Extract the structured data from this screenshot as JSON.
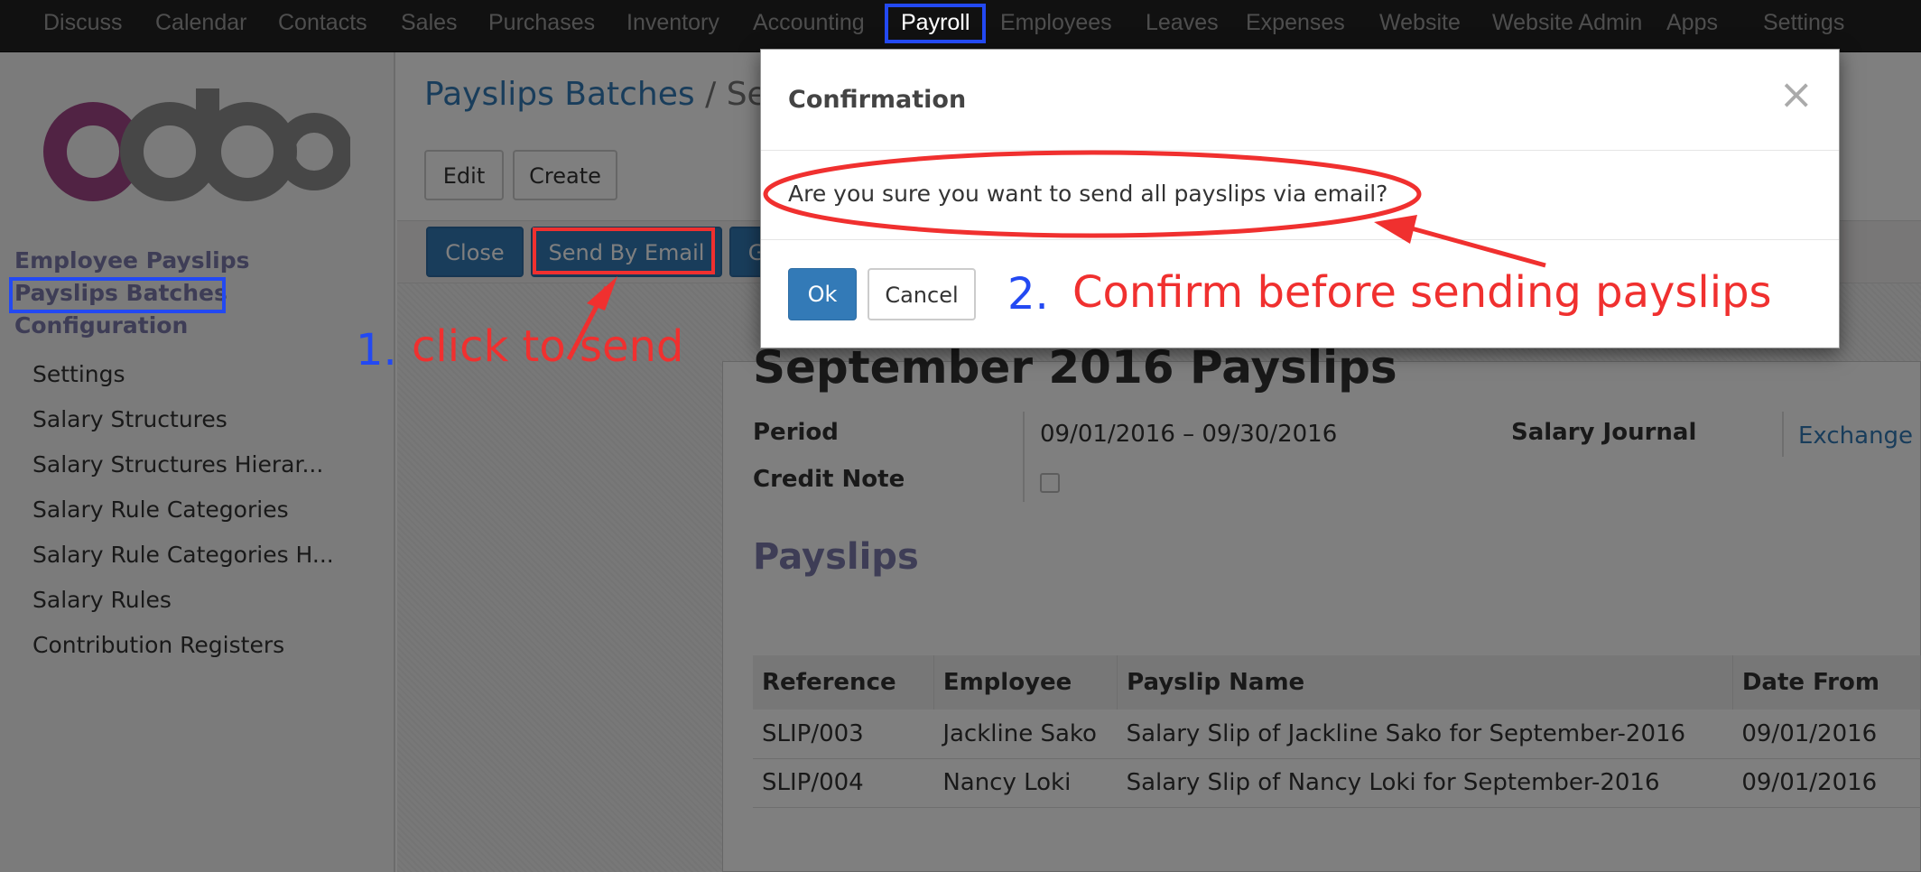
{
  "topbar": {
    "items": [
      "Discuss",
      "Calendar",
      "Contacts",
      "Sales",
      "Purchases",
      "Inventory",
      "Accounting",
      "Payroll",
      "Employees",
      "Leaves",
      "Expenses",
      "Website",
      "Website Admin",
      "Apps",
      "Settings"
    ],
    "active": "Payroll"
  },
  "sidebar": {
    "logo_text": "odoo",
    "employee_payslips": "Employee Payslips",
    "payslips_batches": "Payslips Batches",
    "configuration": "Configuration",
    "config_items": [
      "Settings",
      "Salary Structures",
      "Salary Structures Hierar...",
      "Salary Rule Categories",
      "Salary Rule Categories H...",
      "Salary Rules",
      "Contribution Registers"
    ]
  },
  "breadcrumb": {
    "parent": "Payslips Batches",
    "separator": "/",
    "current": "Se"
  },
  "toolbar": {
    "edit": "Edit",
    "create": "Create"
  },
  "statusbar": {
    "close": "Close",
    "send_by_email": "Send By Email",
    "generate_partial": "G"
  },
  "record": {
    "title": "September 2016 Payslips",
    "period_label": "Period",
    "period_from": "09/01/2016",
    "period_dash": "–",
    "period_to": "09/30/2016",
    "credit_note_label": "Credit Note",
    "salary_journal_label": "Salary Journal",
    "salary_journal_value": "Exchange D",
    "section_title": "Payslips"
  },
  "payslip_table": {
    "headers": [
      "Reference",
      "Employee",
      "Payslip Name",
      "Date From"
    ],
    "rows": [
      [
        "SLIP/003",
        "Jackline Sako",
        "Salary Slip of Jackline Sako for September-2016",
        "09/01/2016"
      ],
      [
        "SLIP/004",
        "Nancy Loki",
        "Salary Slip of Nancy Loki for September-2016",
        "09/01/2016"
      ]
    ]
  },
  "modal": {
    "title": "Confirmation",
    "close_glyph": "×",
    "message": "Are you sure you want to send all payslips via email?",
    "ok": "Ok",
    "cancel": "Cancel"
  },
  "annotations": {
    "step1_num": "1.",
    "step1_text": "click to send",
    "step2_num": "2.",
    "step2_text": "Confirm before sending payslips"
  },
  "colors": {
    "annotation_red": "#f0302f",
    "annotation_blue": "#2349f2",
    "primary": "#337ab7",
    "sidebar_heading": "#7c7bad"
  }
}
